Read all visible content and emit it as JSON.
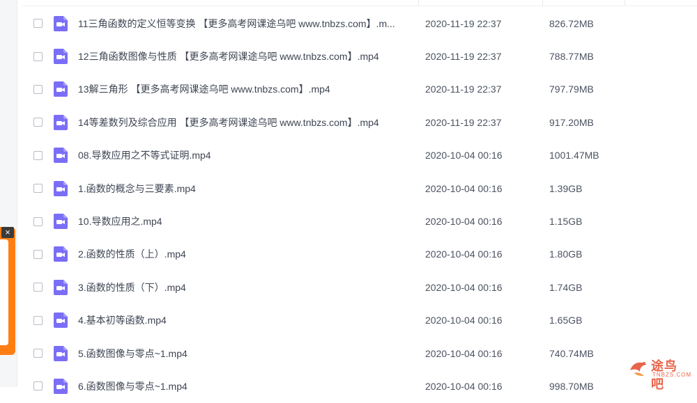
{
  "files": [
    {
      "name": "11三角函数的定义恒等变换 【更多高考网课途乌吧 www.tnbzs.com】.m...",
      "date": "2020-11-19 22:37",
      "size": "826.72MB"
    },
    {
      "name": "12三角函数图像与性质 【更多高考网课途乌吧 www.tnbzs.com】.mp4",
      "date": "2020-11-19 22:37",
      "size": "788.77MB"
    },
    {
      "name": "13解三角形 【更多高考网课途乌吧 www.tnbzs.com】.mp4",
      "date": "2020-11-19 22:37",
      "size": "797.79MB"
    },
    {
      "name": "14等差数列及综合应用 【更多高考网课途乌吧 www.tnbzs.com】.mp4",
      "date": "2020-11-19 22:37",
      "size": "917.20MB"
    },
    {
      "name": "08.导数应用之不等式证明.mp4",
      "date": "2020-10-04 00:16",
      "size": "1001.47MB"
    },
    {
      "name": "1.函数的概念与三要素.mp4",
      "date": "2020-10-04 00:16",
      "size": "1.39GB"
    },
    {
      "name": "10.导数应用之.mp4",
      "date": "2020-10-04 00:16",
      "size": "1.15GB"
    },
    {
      "name": "2.函数的性质（上）.mp4",
      "date": "2020-10-04 00:16",
      "size": "1.80GB"
    },
    {
      "name": "3.函数的性质（下）.mp4",
      "date": "2020-10-04 00:16",
      "size": "1.74GB"
    },
    {
      "name": "4.基本初等函数.mp4",
      "date": "2020-10-04 00:16",
      "size": "1.65GB"
    },
    {
      "name": "5.函数图像与零点~1.mp4",
      "date": "2020-10-04 00:16",
      "size": "740.74MB"
    },
    {
      "name": "6.函数图像与零点~1.mp4",
      "date": "2020-10-04 00:16",
      "size": "998.70MB"
    }
  ],
  "watermark": {
    "text": "途鸟吧",
    "sub": "TNBZS.COM"
  },
  "ad": {
    "close_label": "×"
  },
  "colors": {
    "icon": "#7b6ef6",
    "watermark": "#e34b2c",
    "ad": "#ff7e14"
  }
}
